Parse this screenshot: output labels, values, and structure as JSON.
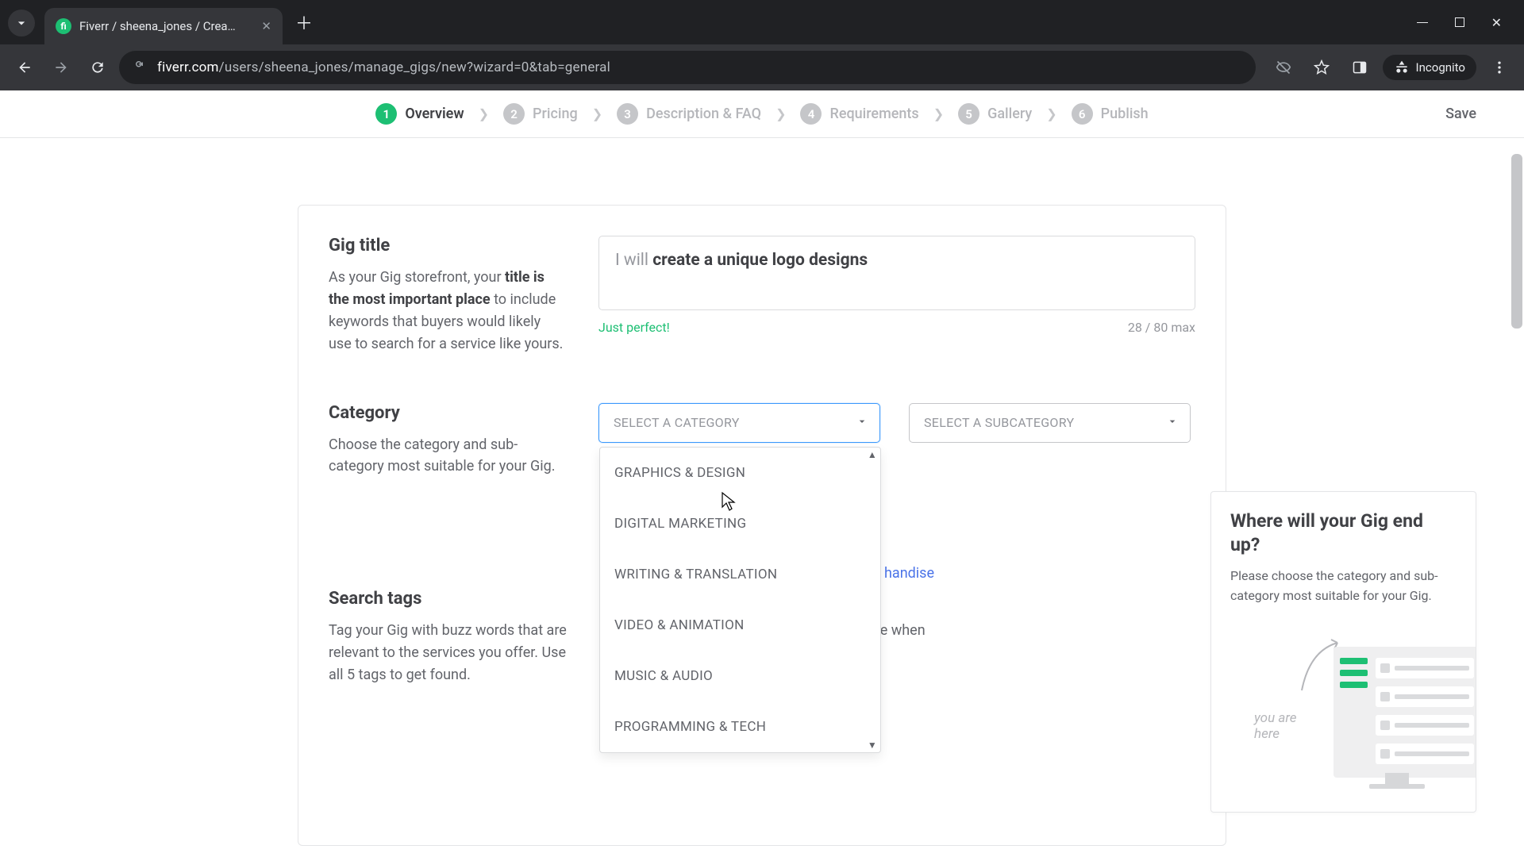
{
  "browser": {
    "tab_title": "Fiverr / sheena_jones / Create a",
    "url_domain": "fiverr.com",
    "url_path": "/users/sheena_jones/manage_gigs/new?wizard=0&tab=general",
    "incognito_label": "Incognito"
  },
  "stepper": {
    "steps": [
      {
        "num": "1",
        "label": "Overview"
      },
      {
        "num": "2",
        "label": "Pricing"
      },
      {
        "num": "3",
        "label": "Description & FAQ"
      },
      {
        "num": "4",
        "label": "Requirements"
      },
      {
        "num": "5",
        "label": "Gallery"
      },
      {
        "num": "6",
        "label": "Publish"
      }
    ],
    "save_label": "Save"
  },
  "gig_title": {
    "label": "Gig title",
    "desc_1": "As your Gig storefront, your ",
    "desc_bold": "title is the most important place",
    "desc_2": " to include keywords that buyers would likely use to search for a service like yours.",
    "prefix": "I will ",
    "value": "create a unique logo designs",
    "hint": "Just perfect!",
    "counter": "28 / 80 max"
  },
  "category": {
    "label": "Category",
    "desc": "Choose the category and sub-category most suitable for your Gig.",
    "select_label": "SELECT A CATEGORY",
    "subselect_label": "SELECT A SUBCATEGORY",
    "options": [
      "GRAPHICS & DESIGN",
      "DIGITAL MARKETING",
      "WRITING & TRANSLATION",
      "VIDEO & ANIMATION",
      "MUSIC & AUDIO",
      "PROGRAMMING & TECH"
    ],
    "peek_link": "handise"
  },
  "search_tags": {
    "label": "Search tags",
    "desc": "Tag your Gig with buzz words that are relevant to the services you offer. Use all 5 tags to get found.",
    "peek_text": "ers will use when"
  },
  "side": {
    "title": "Where will your Gig end up?",
    "text": "Please choose the category and sub-category most suitable for your Gig.",
    "you_are": "you are",
    "here": "here"
  }
}
